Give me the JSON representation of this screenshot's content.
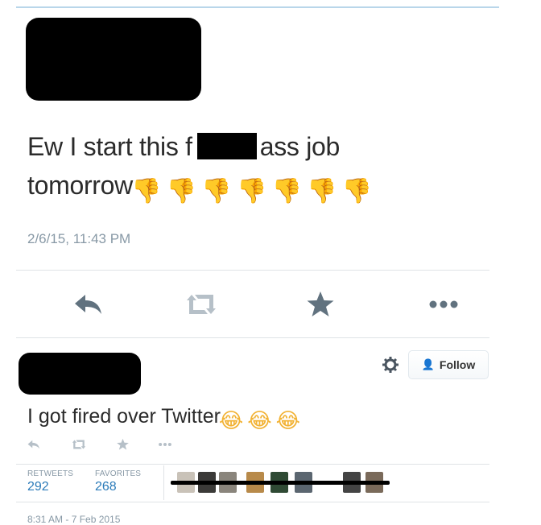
{
  "tweet1": {
    "text_line1_start": "Ew I start this f",
    "text_line1_end": "ass job",
    "text_line2": "tomorrow",
    "emojis": [
      "👎",
      "👎",
      "👎",
      "👎",
      "👎",
      "👎",
      "👎"
    ],
    "timestamp": "2/6/15, 11:43 PM",
    "actions": {
      "reply_icon": "reply-icon",
      "retweet_icon": "retweet-icon",
      "favorite_icon": "star-icon",
      "more_icon": "more-icon"
    }
  },
  "tweet2": {
    "follow_label": "Follow",
    "follow_icon": "👤",
    "text": "I got fired over Twitter",
    "emojis": [
      "😂",
      "😂",
      "😂"
    ],
    "stats": {
      "retweets_label": "RETWEETS",
      "retweets_value": "292",
      "favorites_label": "FAVORITES",
      "favorites_value": "268"
    },
    "timestamp": "8:31 AM - 7 Feb 2015"
  },
  "colors": {
    "icon_gray": "#a0acb5",
    "icon_dark": "#61727f",
    "link_blue": "#2b7bb9",
    "timestamp_gray": "#8899a6"
  }
}
